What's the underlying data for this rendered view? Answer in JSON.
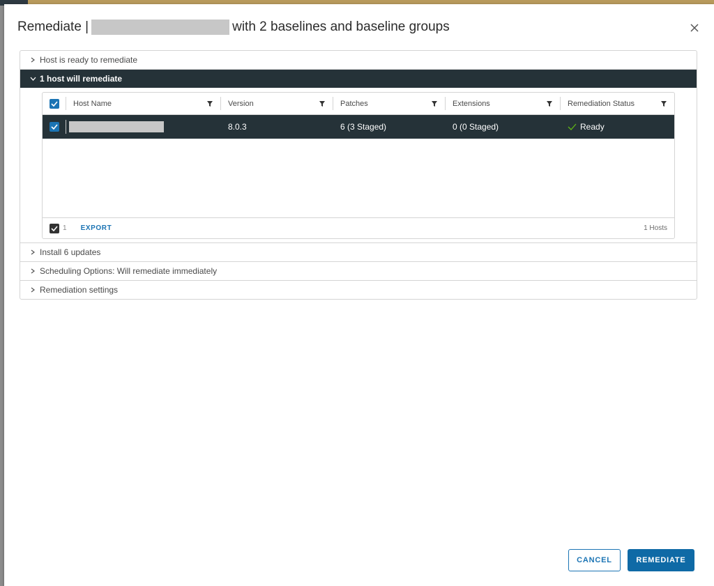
{
  "dialog": {
    "title_prefix": "Remediate |",
    "title_suffix": "with 2 baselines and baseline groups"
  },
  "accordion": [
    {
      "label": "Host is ready to remediate",
      "expanded": false
    },
    {
      "label": "1 host will remediate",
      "expanded": true
    },
    {
      "label": "Install 6 updates",
      "expanded": false
    },
    {
      "label": "Scheduling Options: Will remediate immediately",
      "expanded": false
    },
    {
      "label": "Remediation settings",
      "expanded": false
    }
  ],
  "grid": {
    "columns": [
      "Host Name",
      "Version",
      "Patches",
      "Extensions",
      "Remediation Status"
    ],
    "rows": [
      {
        "host_name": "",
        "version": "8.0.3",
        "patches": "6 (3 Staged)",
        "extensions": "0 (0 Staged)",
        "status": "Ready",
        "selected": true
      }
    ],
    "footer": {
      "selected_count": "1",
      "export_label": "EXPORT",
      "total": "1 Hosts"
    }
  },
  "buttons": {
    "cancel": "CANCEL",
    "remediate": "REMEDIATE"
  },
  "colors": {
    "accent": "#1b74b4",
    "primary_button": "#0f6aa6",
    "selected_row": "#253238",
    "status_ok": "#60b515"
  }
}
